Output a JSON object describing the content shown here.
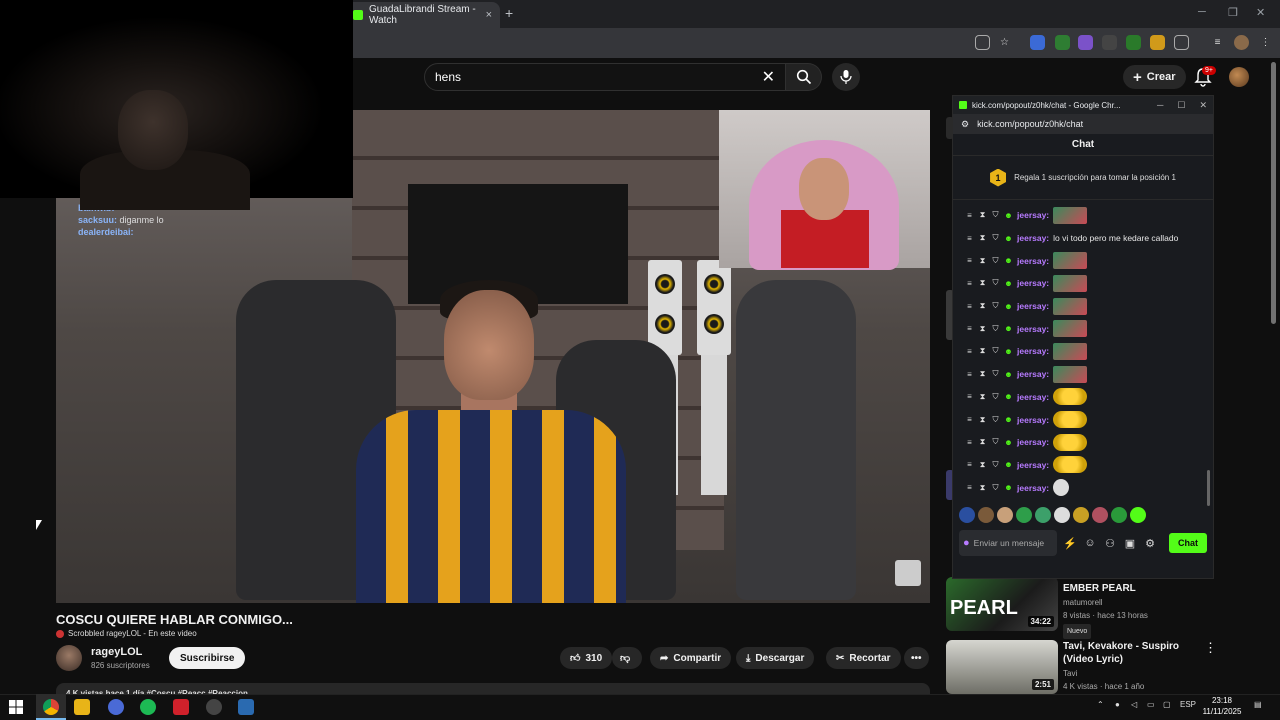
{
  "browser": {
    "tab_title": "GuadaLibrandi Stream - Watch",
    "new_tab": "+",
    "close_tab": "×",
    "win_min": "─",
    "win_max": "❐",
    "win_close": "✕"
  },
  "youtube": {
    "search_value": "hens",
    "create_label": "Crear",
    "notif_count": "9+",
    "video_title": "COSCU QUIERE HABLAR CONMIGO...",
    "scrobbled": "Scrobbled rageyLOL - En este video",
    "channel_name": "rageyLOL",
    "channel_subs": "826 suscriptores",
    "subscribe": "Suscribirse",
    "likes": "310",
    "share": "Compartir",
    "download": "Descargar",
    "clip": "Recortar",
    "more": "•••",
    "desc_line": "4 K vistas hace 1 día #Coscu #Reacc #Reaccion"
  },
  "overlay_chat": [
    {
      "user": "bainwlb:",
      "text": ""
    },
    {
      "user": "sacksuu:",
      "text": "diganme lo"
    },
    {
      "user": "dealerdeibai:",
      "text": ""
    }
  ],
  "kick": {
    "window_title": "kick.com/popout/z0hk/chat - Google Chr...",
    "url": "kick.com/popout/z0hk/chat",
    "chat_header": "Chat",
    "promo_number": "1",
    "promo_text": "Regala 1 suscripción para tomar la posición 1",
    "input_placeholder": "Enviar un mensaje",
    "send_label": "Chat",
    "messages": [
      {
        "user": "jeersay:",
        "text": "",
        "emote": "green"
      },
      {
        "user": "jeersay:",
        "text": "lo vi todo pero me kedare callado",
        "emote": ""
      },
      {
        "user": "jeersay:",
        "text": "",
        "emote": "green"
      },
      {
        "user": "jeersay:",
        "text": "",
        "emote": "green"
      },
      {
        "user": "jeersay:",
        "text": "",
        "emote": "green"
      },
      {
        "user": "jeersay:",
        "text": "",
        "emote": "green"
      },
      {
        "user": "jeersay:",
        "text": "",
        "emote": "green"
      },
      {
        "user": "jeersay:",
        "text": "",
        "emote": "green"
      },
      {
        "user": "jeersay:",
        "text": "",
        "emote": "yellow"
      },
      {
        "user": "jeersay:",
        "text": "",
        "emote": "yellow"
      },
      {
        "user": "jeersay:",
        "text": "",
        "emote": "yellow"
      },
      {
        "user": "jeersay:",
        "text": "",
        "emote": "yellow"
      },
      {
        "user": "jeersay:",
        "text": "",
        "emote": "gray"
      }
    ]
  },
  "recommended": [
    {
      "thumb_text": "PEARL",
      "duration": "34:22",
      "title": "EMBER PEARL",
      "channel": "matumorell",
      "meta": "8 vistas · hace 13 horas",
      "tag": "Nuevo"
    },
    {
      "thumb_text": "",
      "duration": "2:51",
      "title": "Tavi, Kevakore - Suspiro (Video Lyric)",
      "channel": "Tavi",
      "meta": "4 K vistas · hace 1 año",
      "tag": ""
    }
  ],
  "taskbar": {
    "lang": "ESP",
    "time": "23:18",
    "date": "11/11/2025"
  },
  "colors": {
    "kick_green": "#53fc18",
    "kick_user": "#b77bff",
    "yt_bg": "#0f0f0f"
  }
}
